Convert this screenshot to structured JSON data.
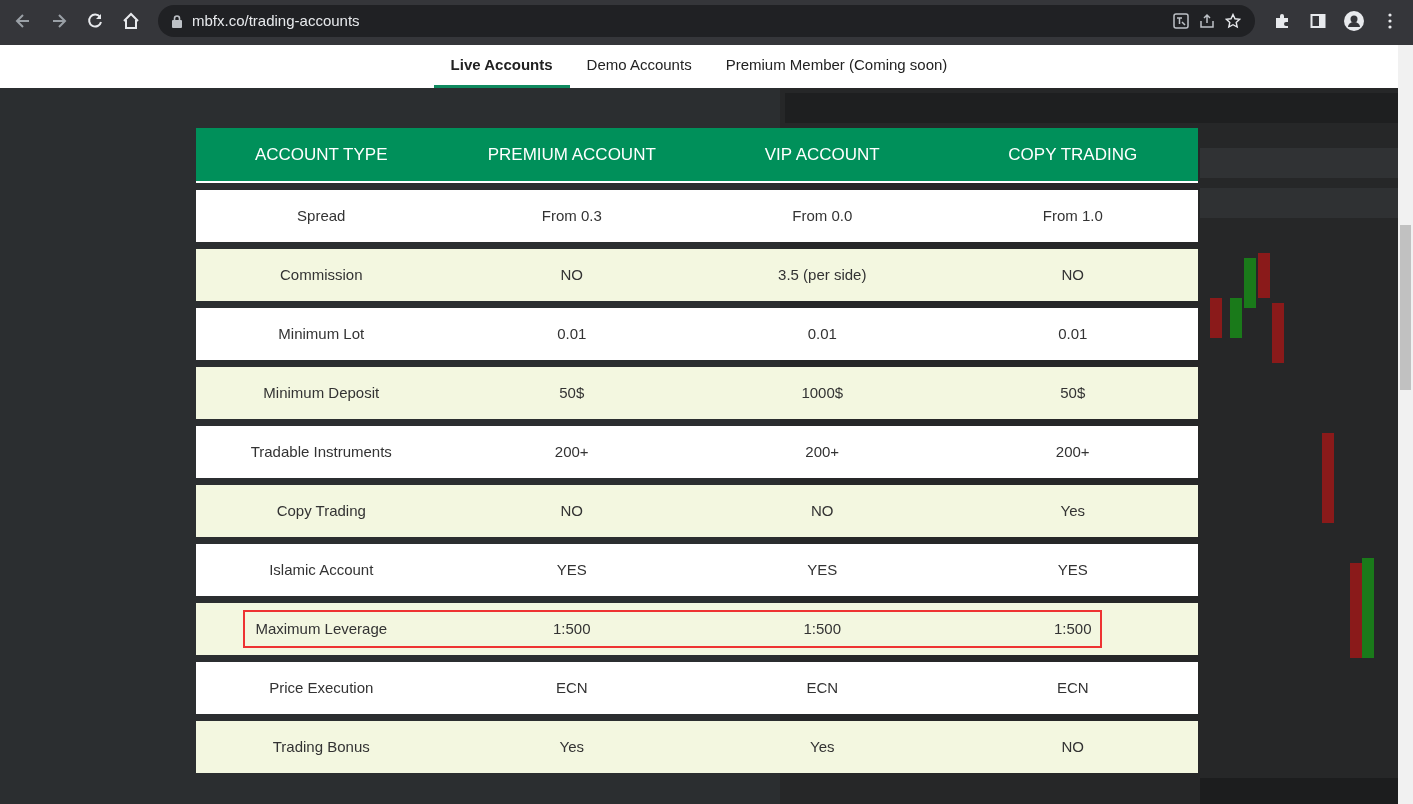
{
  "browser": {
    "url": "mbfx.co/trading-accounts"
  },
  "tabs": [
    {
      "label": "Live Accounts",
      "selected": true
    },
    {
      "label": "Demo Accounts",
      "selected": false
    },
    {
      "label": "Premium Member (Coming soon)",
      "selected": false
    }
  ],
  "table": {
    "columns": [
      "ACCOUNT TYPE",
      "PREMIUM ACCOUNT",
      "VIP ACCOUNT",
      "COPY TRADING"
    ],
    "rows": [
      {
        "cells": [
          "Spread",
          "From 0.3",
          "From 0.0",
          "From 1.0"
        ],
        "highlighted": false
      },
      {
        "cells": [
          "Commission",
          "NO",
          "3.5 (per side)",
          "NO"
        ],
        "highlighted": false
      },
      {
        "cells": [
          "Minimum Lot",
          "0.01",
          "0.01",
          "0.01"
        ],
        "highlighted": false
      },
      {
        "cells": [
          "Minimum Deposit",
          "50$",
          "1000$",
          "50$"
        ],
        "highlighted": false
      },
      {
        "cells": [
          "Tradable Instruments",
          "200+",
          "200+",
          "200+"
        ],
        "highlighted": false
      },
      {
        "cells": [
          "Copy Trading",
          "NO",
          "NO",
          "Yes"
        ],
        "highlighted": false
      },
      {
        "cells": [
          "Islamic Account",
          "YES",
          "YES",
          "YES"
        ],
        "highlighted": false
      },
      {
        "cells": [
          "Maximum Leverage",
          "1:500",
          "1:500",
          "1:500"
        ],
        "highlighted": true
      },
      {
        "cells": [
          "Price Execution",
          "ECN",
          "ECN",
          "ECN"
        ],
        "highlighted": false
      },
      {
        "cells": [
          "Trading Bonus",
          "Yes",
          "Yes",
          "NO"
        ],
        "highlighted": false
      }
    ]
  }
}
